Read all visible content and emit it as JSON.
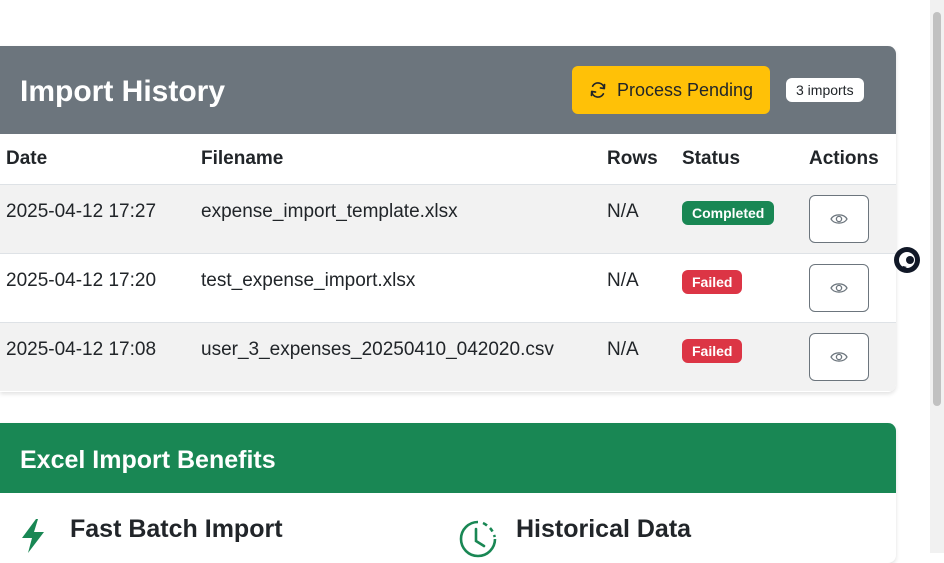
{
  "import_history": {
    "title": "Import History",
    "process_button_label": "Process Pending",
    "count_badge": "3 imports",
    "columns": [
      "Date",
      "Filename",
      "Rows",
      "Status",
      "Actions"
    ],
    "rows": [
      {
        "date": "2025-04-12 17:27",
        "filename": "expense_import_template.xlsx",
        "rows": "N/A",
        "status": "Completed"
      },
      {
        "date": "2025-04-12 17:20",
        "filename": "test_expense_import.xlsx",
        "rows": "N/A",
        "status": "Failed"
      },
      {
        "date": "2025-04-12 17:08",
        "filename": "user_3_expenses_20250410_042020.csv",
        "rows": "N/A",
        "status": "Failed"
      }
    ],
    "colors": {
      "header": "#6c757d",
      "button": "#ffc107",
      "completed": "#198754",
      "failed": "#dc3545"
    }
  },
  "benefits": {
    "title": "Excel Import Benefits",
    "features": [
      {
        "title": "Fast Batch Import",
        "icon": "lightning-icon"
      },
      {
        "title": "Historical Data",
        "icon": "clock-icon"
      }
    ],
    "colors": {
      "header": "#198754"
    }
  }
}
